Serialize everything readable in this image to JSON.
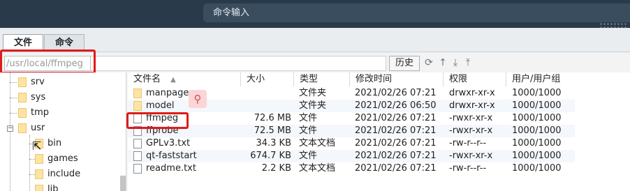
{
  "command_bar": {
    "placeholder": "命令输入"
  },
  "tabs": [
    {
      "label": "文件",
      "active": true
    },
    {
      "label": "命令",
      "active": false
    }
  ],
  "path_bar": {
    "path": "/usr/local/ffmpeg",
    "history_label": "历史"
  },
  "toolbar_icons": [
    "refresh-icon",
    "up-icon",
    "download-icon",
    "upload-icon"
  ],
  "tree": {
    "items": [
      {
        "label": "srv"
      },
      {
        "label": "sys"
      },
      {
        "label": "tmp"
      },
      {
        "label": "usr",
        "expanded": true
      },
      {
        "label": "bin"
      },
      {
        "label": "games"
      },
      {
        "label": "include"
      },
      {
        "label": "lib"
      }
    ]
  },
  "file_table": {
    "columns": [
      "文件名",
      "大小",
      "类型",
      "修改时间",
      "权限",
      "用户/用户组"
    ],
    "sort_indicator": "▲",
    "rows": [
      {
        "name": "manpages",
        "size": "",
        "type": "文件夹",
        "modified": "2021/02/26 07:21",
        "perm": "drwxr-xr-x",
        "owner": "1000/1000",
        "kind": "folder"
      },
      {
        "name": "model",
        "size": "",
        "type": "文件夹",
        "modified": "2021/02/26 06:50",
        "perm": "drwxr-xr-x",
        "owner": "1000/1000",
        "kind": "folder"
      },
      {
        "name": "ffmpeg",
        "size": "72.6 MB",
        "type": "文件",
        "modified": "2021/02/26 07:21",
        "perm": "-rwxr-xr-x",
        "owner": "1000/1000",
        "kind": "file"
      },
      {
        "name": "ffprobe",
        "size": "72.5 MB",
        "type": "文件",
        "modified": "2021/02/26 07:21",
        "perm": "-rwxr-xr-x",
        "owner": "1000/1000",
        "kind": "file"
      },
      {
        "name": "GPLv3.txt",
        "size": "34.3 KB",
        "type": "文本文档",
        "modified": "2021/02/26 07:21",
        "perm": "-rw-r--r--",
        "owner": "1000/1000",
        "kind": "file"
      },
      {
        "name": "qt-faststart",
        "size": "674.7 KB",
        "type": "文件",
        "modified": "2021/02/26 07:21",
        "perm": "-rwxr-xr-x",
        "owner": "1000/1000",
        "kind": "file"
      },
      {
        "name": "readme.txt",
        "size": "2.2 KB",
        "type": "文本文档",
        "modified": "2021/02/26 07:21",
        "perm": "-rw-r--r--",
        "owner": "1000/1000",
        "kind": "file"
      }
    ]
  },
  "colors": {
    "highlight": "#e01b1b",
    "topbar": "#293a4a"
  }
}
